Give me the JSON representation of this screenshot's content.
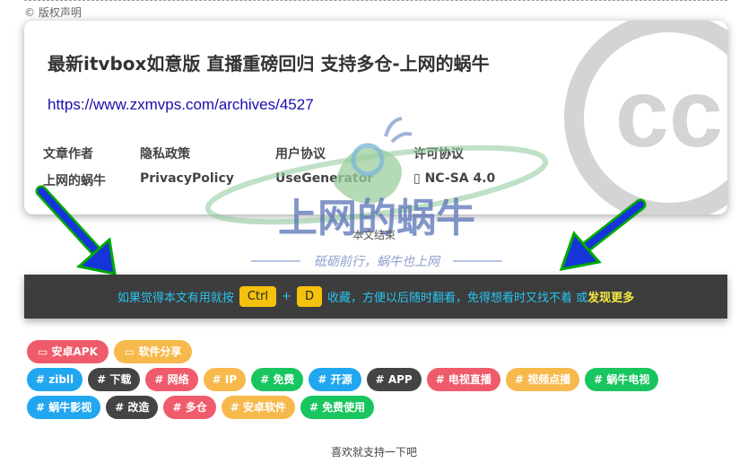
{
  "copyright_label": "© 版权声明",
  "card": {
    "title": "最新itvbox如意版 直播重磅回归 支持多仓-上网的蜗牛",
    "url": "https://www.zxmvps.com/archives/4527",
    "meta": [
      {
        "label": "文章作者",
        "value": "上网的蜗牛"
      },
      {
        "label": "隐私政策",
        "value": "PrivacyPolicy"
      },
      {
        "label": "用户协议",
        "value": "UseGenerator"
      },
      {
        "label": "许可协议",
        "value": "NC-SA 4.0"
      }
    ]
  },
  "watermark": {
    "title": "上网的蜗牛",
    "slogan": "砥砺前行，蜗牛也上网"
  },
  "end_text": "本文结束",
  "tip": {
    "prefix": "如果觉得本文有用就按",
    "key1": "Ctrl",
    "plus": "+",
    "key2": "D",
    "suffix": "收藏，方便以后随时翻看，免得想看时又找不着 或",
    "link": "发现更多"
  },
  "categories": [
    {
      "label": "安卓APK",
      "color": "#ef5b6b"
    },
    {
      "label": "软件分享",
      "color": "#f7b94b"
    }
  ],
  "tags_row1": [
    {
      "label": "# zibll",
      "color": "#21a6f0"
    },
    {
      "label": "# 下载",
      "color": "#444444"
    },
    {
      "label": "# 网络",
      "color": "#ef5b6b"
    },
    {
      "label": "# IP",
      "color": "#f7b94b"
    },
    {
      "label": "# 免费",
      "color": "#19c55e"
    },
    {
      "label": "# 开源",
      "color": "#21a6f0"
    },
    {
      "label": "# APP",
      "color": "#444444"
    },
    {
      "label": "# 电视直播",
      "color": "#ef5b6b"
    },
    {
      "label": "# 视频点播",
      "color": "#f7b94b"
    },
    {
      "label": "# 蜗牛电视",
      "color": "#19c55e"
    }
  ],
  "tags_row2": [
    {
      "label": "# 蜗牛影视",
      "color": "#21a6f0"
    },
    {
      "label": "# 改造",
      "color": "#444444"
    },
    {
      "label": "# 多仓",
      "color": "#ef5b6b"
    },
    {
      "label": "# 安卓软件",
      "color": "#f7b94b"
    },
    {
      "label": "# 免费使用",
      "color": "#19c55e"
    }
  ],
  "support_text": "喜欢就支持一下吧"
}
